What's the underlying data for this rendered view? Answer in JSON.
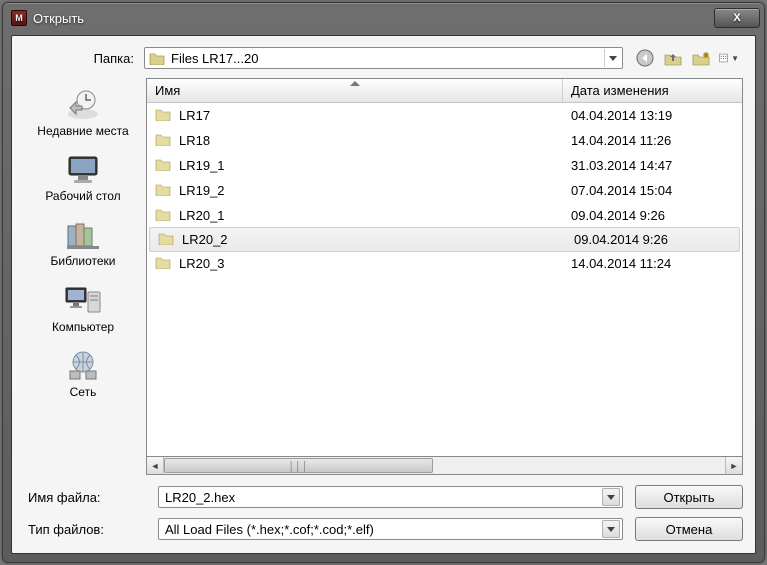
{
  "window": {
    "title": "Открыть",
    "close_glyph": "X"
  },
  "folder": {
    "label": "Папка:",
    "value": "Files LR17...20"
  },
  "columns": {
    "name": "Имя",
    "date": "Дата изменения"
  },
  "files": [
    {
      "name": "LR17",
      "date": "04.04.2014 13:19",
      "selected": false
    },
    {
      "name": "LR18",
      "date": "14.04.2014 11:26",
      "selected": false
    },
    {
      "name": "LR19_1",
      "date": "31.03.2014 14:47",
      "selected": false
    },
    {
      "name": "LR19_2",
      "date": "07.04.2014 15:04",
      "selected": false
    },
    {
      "name": "LR20_1",
      "date": "09.04.2014 9:26",
      "selected": false
    },
    {
      "name": "LR20_2",
      "date": "09.04.2014 9:26",
      "selected": true
    },
    {
      "name": "LR20_3",
      "date": "14.04.2014 11:24",
      "selected": false
    }
  ],
  "sidebar": [
    {
      "key": "recent",
      "label": "Недавние места"
    },
    {
      "key": "desktop",
      "label": "Рабочий стол"
    },
    {
      "key": "libraries",
      "label": "Библиотеки"
    },
    {
      "key": "computer",
      "label": "Компьютер"
    },
    {
      "key": "network",
      "label": "Сеть"
    }
  ],
  "bottom": {
    "filename_label": "Имя файла:",
    "filename_value": "LR20_2.hex",
    "filetype_label": "Тип файлов:",
    "filetype_value": "All Load Files (*.hex;*.cof;*.cod;*.elf)",
    "open_btn": "Открыть",
    "cancel_btn": "Отмена"
  }
}
